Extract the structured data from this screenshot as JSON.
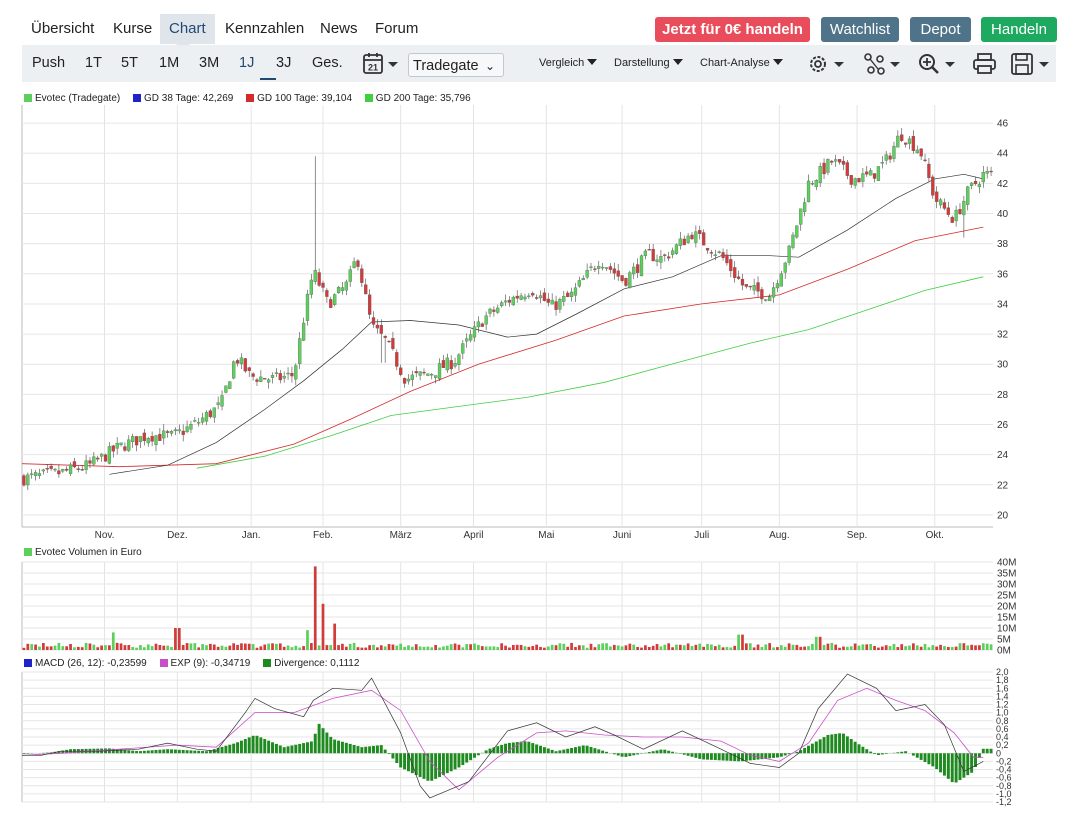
{
  "nav": {
    "tabs": [
      "Übersicht",
      "Kurse",
      "Chart",
      "Kennzahlen",
      "News",
      "Forum"
    ],
    "active_tab": "Chart",
    "buttons": {
      "trade_free": "Jetzt für 0€ handeln",
      "watchlist": "Watchlist",
      "depot": "Depot",
      "trade": "Handeln"
    }
  },
  "toolbar": {
    "ranges": [
      "Push",
      "1T",
      "5T",
      "1M",
      "3M",
      "1J",
      "3J",
      "Ges."
    ],
    "active_range": "1J",
    "calendar_day": "21",
    "exchange": "Tradegate",
    "menus": {
      "compare": "Vergleich",
      "display": "Darstellung",
      "analysis": "Chart-Analyse"
    },
    "icons": [
      "settings-icon",
      "indicators-icon",
      "zoom-icon",
      "print-icon",
      "save-icon"
    ]
  },
  "price_legend": {
    "main": "Evotec (Tradegate)",
    "gd38": "GD 38 Tage: 42,269",
    "gd100": "GD 100 Tage: 39,104",
    "gd200": "GD 200 Tage: 35,796",
    "colors": {
      "main": "#5ccf5c",
      "gd38": "#1f24c9",
      "gd100": "#d42a2a",
      "gd200": "#3fcf3f",
      "up": "#5ccf5c",
      "down": "#d23b3b"
    }
  },
  "volume_legend": "Evotec Volumen in Euro",
  "macd_legend": {
    "macd": "MACD (26, 12): -0,23599",
    "exp": "EXP (9): -0,34719",
    "divergence": "Divergence: 0,1112",
    "colors": {
      "macd": "#1f24c9",
      "exp": "#c94fc9",
      "divergence": "#1f8a1f"
    }
  },
  "chart_data": [
    {
      "type": "candlestick",
      "title": "Evotec (Tradegate)",
      "x_ticks": [
        "Nov.",
        "Dez.",
        "Jan.",
        "Feb.",
        "März",
        "April",
        "Mai",
        "Juni",
        "Juli",
        "Aug.",
        "Sep.",
        "Okt."
      ],
      "y_ticks": [
        "20",
        "22",
        "24",
        "26",
        "28",
        "30",
        "32",
        "34",
        "36",
        "38",
        "40",
        "42",
        "44",
        "46"
      ],
      "ylim": [
        19.2,
        47.2
      ],
      "grid": true,
      "close_path": [
        [
          0,
          22.4
        ],
        [
          0.04,
          22.8
        ],
        [
          0.07,
          23.3
        ],
        [
          0.1,
          24.5
        ],
        [
          0.13,
          25.3
        ],
        [
          0.155,
          25.2
        ],
        [
          0.18,
          26.1
        ],
        [
          0.205,
          27.3
        ],
        [
          0.22,
          30.5
        ],
        [
          0.235,
          29.2
        ],
        [
          0.26,
          29.0
        ],
        [
          0.28,
          29.3
        ],
        [
          0.29,
          33.0
        ],
        [
          0.3,
          36.2
        ],
        [
          0.315,
          34.0
        ],
        [
          0.335,
          35.3
        ],
        [
          0.345,
          37.2
        ],
        [
          0.36,
          32.5
        ],
        [
          0.375,
          31.5
        ],
        [
          0.395,
          29.0
        ],
        [
          0.42,
          29.4
        ],
        [
          0.445,
          30.2
        ],
        [
          0.475,
          33.0
        ],
        [
          0.5,
          34.2
        ],
        [
          0.525,
          35.0
        ],
        [
          0.545,
          33.8
        ],
        [
          0.565,
          34.5
        ],
        [
          0.595,
          37.0
        ],
        [
          0.62,
          35.5
        ],
        [
          0.645,
          37.3
        ],
        [
          0.66,
          37.0
        ],
        [
          0.69,
          38.7
        ],
        [
          0.72,
          37.2
        ],
        [
          0.745,
          35.0
        ],
        [
          0.77,
          34.6
        ],
        [
          0.79,
          37.5
        ],
        [
          0.81,
          42.0
        ],
        [
          0.835,
          43.5
        ],
        [
          0.855,
          42.3
        ],
        [
          0.875,
          42.5
        ],
        [
          0.89,
          43.5
        ],
        [
          0.905,
          45.3
        ],
        [
          0.925,
          44.2
        ],
        [
          0.94,
          41.0
        ],
        [
          0.96,
          39.6
        ],
        [
          0.975,
          41.5
        ],
        [
          0.99,
          42.6
        ]
      ],
      "gd38_path": [
        [
          0.09,
          22.7
        ],
        [
          0.15,
          23.3
        ],
        [
          0.2,
          24.8
        ],
        [
          0.25,
          27.0
        ],
        [
          0.29,
          28.9
        ],
        [
          0.33,
          31.0
        ],
        [
          0.36,
          32.8
        ],
        [
          0.4,
          32.9
        ],
        [
          0.45,
          32.6
        ],
        [
          0.5,
          31.8
        ],
        [
          0.53,
          32.0
        ],
        [
          0.57,
          33.3
        ],
        [
          0.62,
          35.0
        ],
        [
          0.67,
          35.8
        ],
        [
          0.72,
          37.2
        ],
        [
          0.77,
          37.2
        ],
        [
          0.8,
          37.1
        ],
        [
          0.85,
          38.9
        ],
        [
          0.9,
          41.0
        ],
        [
          0.94,
          42.3
        ],
        [
          0.97,
          42.6
        ],
        [
          0.99,
          42.3
        ]
      ],
      "gd100_path": [
        [
          0,
          23.4
        ],
        [
          0.1,
          23.2
        ],
        [
          0.2,
          23.4
        ],
        [
          0.28,
          24.7
        ],
        [
          0.34,
          26.4
        ],
        [
          0.4,
          28.2
        ],
        [
          0.47,
          30.0
        ],
        [
          0.55,
          31.6
        ],
        [
          0.62,
          33.2
        ],
        [
          0.7,
          34.0
        ],
        [
          0.78,
          34.6
        ],
        [
          0.85,
          36.3
        ],
        [
          0.92,
          38.2
        ],
        [
          0.99,
          39.1
        ]
      ],
      "gd200_path": [
        [
          0.18,
          23.1
        ],
        [
          0.25,
          23.9
        ],
        [
          0.32,
          25.3
        ],
        [
          0.38,
          26.6
        ],
        [
          0.45,
          27.2
        ],
        [
          0.52,
          27.8
        ],
        [
          0.6,
          28.8
        ],
        [
          0.68,
          30.2
        ],
        [
          0.75,
          31.4
        ],
        [
          0.81,
          32.3
        ],
        [
          0.87,
          33.6
        ],
        [
          0.93,
          34.9
        ],
        [
          0.99,
          35.8
        ]
      ],
      "spikes": [
        {
          "x": 0.303,
          "high": 43.8
        },
        {
          "x": 0.372,
          "low": 30.1
        },
        {
          "x": 0.97,
          "low": 38.4
        }
      ]
    },
    {
      "type": "bar",
      "title": "Evotec Volumen in Euro",
      "y_ticks": [
        "0M",
        "5M",
        "10M",
        "15M",
        "20M",
        "25M",
        "30M",
        "35M",
        "40M"
      ],
      "ylim": [
        0,
        40
      ],
      "unit": "M",
      "peaks": [
        {
          "x": 0.303,
          "value": 38
        },
        {
          "x": 0.31,
          "value": 21
        },
        {
          "x": 0.295,
          "value": 9
        },
        {
          "x": 0.322,
          "value": 12
        },
        {
          "x": 0.16,
          "value": 10
        },
        {
          "x": 0.095,
          "value": 8
        },
        {
          "x": 0.74,
          "value": 7
        },
        {
          "x": 0.82,
          "value": 6
        }
      ],
      "base_level": 2.5
    },
    {
      "type": "line",
      "title": "MACD",
      "y_ticks": [
        "2,0",
        "1,8",
        "1,6",
        "1,4",
        "1,2",
        "1,0",
        "0,8",
        "0,6",
        "0,4",
        "0,2",
        "0",
        "-0,2",
        "-0,4",
        "-0,6",
        "-0,8",
        "-1,0",
        "-1,2"
      ],
      "ylim": [
        -1.2,
        2.0
      ],
      "macd_path": [
        [
          0,
          -0.05
        ],
        [
          0.02,
          -0.05
        ],
        [
          0.04,
          0.05
        ],
        [
          0.08,
          0.05
        ],
        [
          0.12,
          0.1
        ],
        [
          0.15,
          0.25
        ],
        [
          0.18,
          0.1
        ],
        [
          0.2,
          0.05
        ],
        [
          0.23,
          1.0
        ],
        [
          0.24,
          1.35
        ],
        [
          0.26,
          1.1
        ],
        [
          0.29,
          0.9
        ],
        [
          0.3,
          1.3
        ],
        [
          0.32,
          1.6
        ],
        [
          0.35,
          1.55
        ],
        [
          0.36,
          1.85
        ],
        [
          0.39,
          0.5
        ],
        [
          0.41,
          -0.8
        ],
        [
          0.42,
          -1.1
        ],
        [
          0.46,
          -0.7
        ],
        [
          0.5,
          0.55
        ],
        [
          0.53,
          0.75
        ],
        [
          0.56,
          0.4
        ],
        [
          0.59,
          0.65
        ],
        [
          0.61,
          0.45
        ],
        [
          0.64,
          0.1
        ],
        [
          0.68,
          0.55
        ],
        [
          0.72,
          0.1
        ],
        [
          0.75,
          -0.25
        ],
        [
          0.78,
          -0.35
        ],
        [
          0.8,
          0.0
        ],
        [
          0.82,
          1.1
        ],
        [
          0.85,
          1.95
        ],
        [
          0.88,
          1.6
        ],
        [
          0.9,
          1.05
        ],
        [
          0.93,
          1.2
        ],
        [
          0.95,
          0.7
        ],
        [
          0.97,
          -0.45
        ],
        [
          0.99,
          -0.2
        ]
      ],
      "exp_path": [
        [
          0,
          -0.05
        ],
        [
          0.04,
          0.0
        ],
        [
          0.1,
          0.1
        ],
        [
          0.16,
          0.2
        ],
        [
          0.2,
          0.15
        ],
        [
          0.24,
          1.0
        ],
        [
          0.28,
          1.0
        ],
        [
          0.32,
          1.35
        ],
        [
          0.36,
          1.55
        ],
        [
          0.39,
          1.05
        ],
        [
          0.42,
          -0.2
        ],
        [
          0.45,
          -0.9
        ],
        [
          0.49,
          -0.1
        ],
        [
          0.53,
          0.5
        ],
        [
          0.56,
          0.55
        ],
        [
          0.6,
          0.45
        ],
        [
          0.64,
          0.4
        ],
        [
          0.68,
          0.4
        ],
        [
          0.72,
          0.3
        ],
        [
          0.75,
          -0.05
        ],
        [
          0.78,
          -0.2
        ],
        [
          0.81,
          0.25
        ],
        [
          0.84,
          1.3
        ],
        [
          0.87,
          1.6
        ],
        [
          0.9,
          1.3
        ],
        [
          0.93,
          1.05
        ],
        [
          0.96,
          0.5
        ],
        [
          0.98,
          -0.1
        ],
        [
          0.99,
          -0.1
        ]
      ],
      "divergence_path": [
        [
          0,
          -0.02
        ],
        [
          0.03,
          0.02
        ],
        [
          0.05,
          0.1
        ],
        [
          0.09,
          0.12
        ],
        [
          0.12,
          0.05
        ],
        [
          0.15,
          0.1
        ],
        [
          0.19,
          0.05
        ],
        [
          0.22,
          0.25
        ],
        [
          0.24,
          0.45
        ],
        [
          0.27,
          0.15
        ],
        [
          0.3,
          0.3
        ],
        [
          0.305,
          0.75
        ],
        [
          0.32,
          0.35
        ],
        [
          0.35,
          0.15
        ],
        [
          0.37,
          0.2
        ],
        [
          0.39,
          -0.35
        ],
        [
          0.42,
          -0.7
        ],
        [
          0.45,
          -0.35
        ],
        [
          0.48,
          0.1
        ],
        [
          0.5,
          0.25
        ],
        [
          0.52,
          0.3
        ],
        [
          0.55,
          0.05
        ],
        [
          0.58,
          0.2
        ],
        [
          0.62,
          -0.1
        ],
        [
          0.66,
          0.1
        ],
        [
          0.7,
          -0.15
        ],
        [
          0.74,
          -0.2
        ],
        [
          0.78,
          -0.1
        ],
        [
          0.8,
          0.05
        ],
        [
          0.83,
          0.45
        ],
        [
          0.845,
          0.5
        ],
        [
          0.86,
          0.25
        ],
        [
          0.88,
          -0.05
        ],
        [
          0.91,
          0.05
        ],
        [
          0.94,
          -0.35
        ],
        [
          0.96,
          -0.75
        ],
        [
          0.98,
          -0.45
        ],
        [
          0.99,
          0.11
        ]
      ]
    }
  ]
}
